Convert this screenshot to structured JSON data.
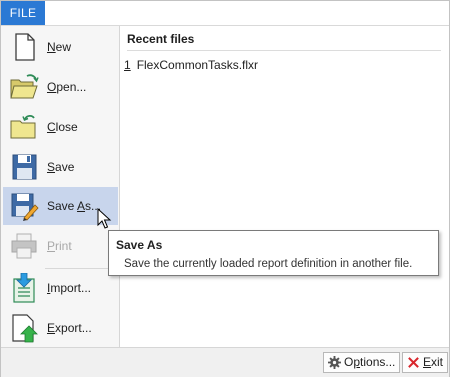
{
  "header": {
    "file_tab": "FILE"
  },
  "commands": [
    {
      "pre": "",
      "u": "N",
      "post": "ew",
      "icon": "new-document-icon"
    },
    {
      "pre": "",
      "u": "O",
      "post": "pen...",
      "icon": "open-folder-icon"
    },
    {
      "pre": "",
      "u": "C",
      "post": "lose",
      "icon": "close-folder-icon"
    },
    {
      "pre": "",
      "u": "S",
      "post": "ave",
      "icon": "save-icon"
    },
    {
      "pre": "Save ",
      "u": "A",
      "post": "s...",
      "icon": "save-as-icon"
    },
    {
      "pre": "",
      "u": "P",
      "post": "rint",
      "icon": "print-icon"
    },
    {
      "pre": "",
      "u": "I",
      "post": "mport...",
      "icon": "import-icon"
    },
    {
      "pre": "",
      "u": "E",
      "post": "xport...",
      "icon": "export-icon"
    }
  ],
  "recent": {
    "title": "Recent files",
    "items": [
      {
        "num": "1",
        "name": "FlexCommonTasks.flxr"
      }
    ]
  },
  "buttons": {
    "options_pre": "O",
    "options_u": "p",
    "options_post": "tions...",
    "exit_pre": "",
    "exit_u": "E",
    "exit_post": "xit"
  },
  "tooltip": {
    "title": "Save As",
    "description": "Save the currently loaded report definition in another file."
  },
  "colors": {
    "accent": "#2b79d4",
    "selected": "#c8d5ec",
    "disabled_text": "#a8a8a8"
  }
}
